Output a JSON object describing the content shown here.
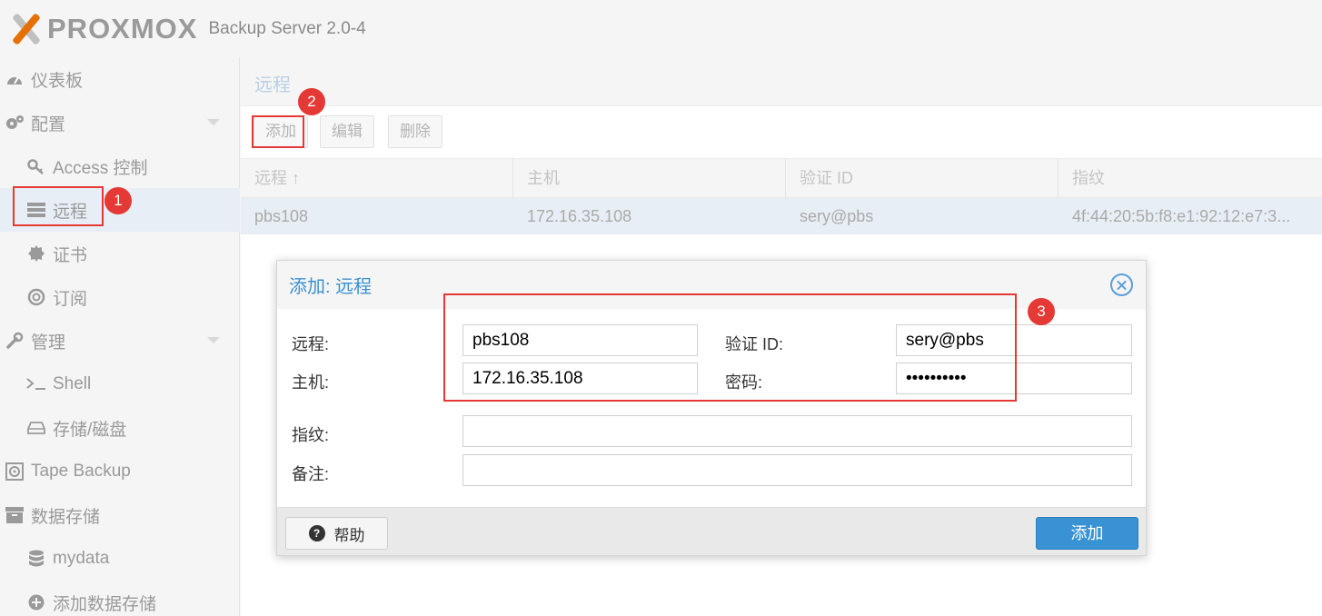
{
  "header": {
    "logo_text": "PROXMOX",
    "app_title": "Backup Server 2.0-4"
  },
  "sidebar": {
    "items": [
      {
        "label": "仪表板",
        "icon": "dashboard-icon"
      },
      {
        "label": "配置",
        "icon": "gears-icon"
      },
      {
        "label": "Access 控制",
        "icon": "key-icon"
      },
      {
        "label": "远程",
        "icon": "server-icon"
      },
      {
        "label": "证书",
        "icon": "certificate-icon"
      },
      {
        "label": "订阅",
        "icon": "support-icon"
      },
      {
        "label": "管理",
        "icon": "wrench-icon"
      },
      {
        "label": "Shell",
        "icon": "terminal-icon"
      },
      {
        "label": "存储/磁盘",
        "icon": "hdd-icon"
      },
      {
        "label": "Tape Backup",
        "icon": "tape-icon"
      },
      {
        "label": "数据存储",
        "icon": "archive-icon"
      },
      {
        "label": "mydata",
        "icon": "database-icon"
      },
      {
        "label": "添加数据存储",
        "icon": "plus-circle-icon"
      }
    ]
  },
  "panel": {
    "title": "远程",
    "toolbar": {
      "add": "添加",
      "edit": "编辑",
      "remove": "删除"
    },
    "columns": [
      "远程 ↑",
      "主机",
      "验证 ID",
      "指纹"
    ],
    "rows": [
      [
        "pbs108",
        "172.16.35.108",
        "sery@pbs",
        "4f:44:20:5b:f8:e1:92:12:e7:3..."
      ]
    ]
  },
  "dialog": {
    "title": "添加: 远程",
    "labels": {
      "remote": "远程:",
      "host": "主机:",
      "auth_id": "验证 ID:",
      "password": "密码:",
      "fingerprint": "指纹:",
      "comment": "备注:"
    },
    "values": {
      "remote": "pbs108",
      "host": "172.16.35.108",
      "auth_id": "sery@pbs",
      "password": "sery@pbs12",
      "fingerprint": "",
      "comment": ""
    },
    "help_label": "帮助",
    "submit_label": "添加"
  },
  "annotations": [
    "1",
    "2",
    "3"
  ],
  "colors": {
    "accent": "#3892d4",
    "brand_orange": "#e57000",
    "annotation_red": "#e53935"
  }
}
